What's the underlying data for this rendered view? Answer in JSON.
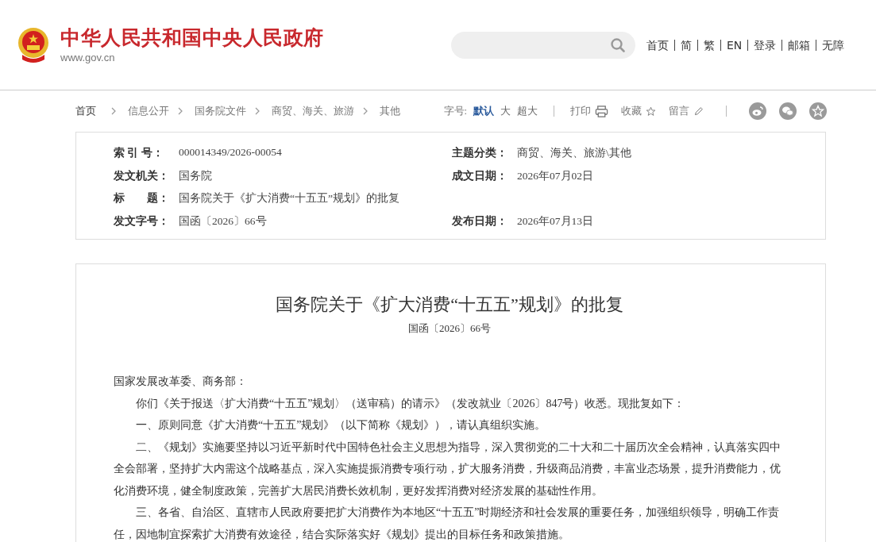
{
  "header": {
    "site_title": "中华人民共和国中央人民政府",
    "domain": "www.gov.cn",
    "nav": [
      "首页",
      "简",
      "繁",
      "EN",
      "登录",
      "邮箱",
      "无障"
    ]
  },
  "breadcrumb": [
    "首页",
    "信息公开",
    "国务院文件",
    "商贸、海关、旅游",
    "其他"
  ],
  "tools": {
    "font_size_label": "字号:",
    "font_sizes": [
      {
        "label": "默认",
        "selected": true
      },
      {
        "label": "大",
        "selected": false
      },
      {
        "label": "超大",
        "selected": false
      }
    ],
    "actions": [
      {
        "label": "打印",
        "kind": "print"
      },
      {
        "label": "收藏",
        "kind": "star"
      },
      {
        "label": "留言",
        "kind": "pen"
      }
    ],
    "share": [
      {
        "kind": "weibo"
      },
      {
        "kind": "wechat"
      },
      {
        "kind": "favorite"
      }
    ]
  },
  "meta": [
    [
      {
        "label": "索 引 号：",
        "value": "000014349/2026-00054"
      },
      {
        "label": "主题分类：",
        "value": "商贸、海关、旅游\\其他"
      }
    ],
    [
      {
        "label": "发文机关：",
        "value": "国务院"
      },
      {
        "label": "成文日期：",
        "value": "2026年07月02日"
      }
    ],
    [
      {
        "label": "标　　题：",
        "value": "国务院关于《扩大消费“十五五”规划》的批复"
      }
    ],
    [
      {
        "label": "发文字号：",
        "value": "国函〔2026〕66号"
      },
      {
        "label": "发布日期：",
        "value": "2026年07月13日"
      }
    ]
  ],
  "article": {
    "title": "国务院关于《扩大消费“十五五”规划》的批复",
    "doc_number": "国函〔2026〕66号",
    "salutation": "国家发展改革委、商务部：",
    "paragraphs": [
      "你们《关于报送〈扩大消费“十五五”规划〉（送审稿）的请示》（发改就业〔2026〕847号）收悉。现批复如下：",
      "一、原则同意《扩大消费“十五五”规划》（以下简称《规划》），请认真组织实施。",
      "二、《规划》实施要坚持以习近平新时代中国特色社会主义思想为指导，深入贯彻党的二十大和二十届历次全会精神，认真落实四中全会部署，坚持扩大内需这个战略基点，深入实施提振消费专项行动，扩大服务消费，升级商品消费，丰富业态场景，提升消费能力，优化消费环境，健全制度政策，完善扩大居民消费长效机制，更好发挥消费对经济发展的基础性作用。",
      "三、各省、自治区、直辖市人民政府要把扩大消费作为本地区“十五五”时期经济和社会发展的重要任务，加强组织领导，明确工作责任，因地制宜探索扩大消费有效途径，结合实际落实好《规划》提出的目标任务和政策措施。"
    ]
  }
}
